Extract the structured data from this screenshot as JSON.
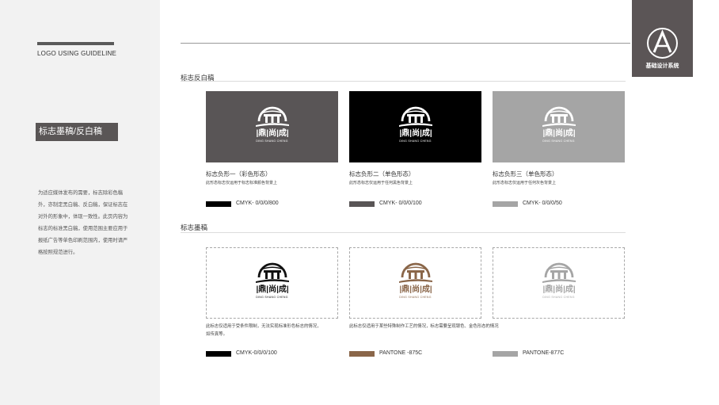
{
  "sidebar": {
    "guide_title": "LOGO USING GUIDELINE",
    "section_title": "标志墨稿/反白稿",
    "description": "为适应媒体发布的需要，标志除彩色稿外，亦制定黑白稿、反白稿，保证标志在对外的形象中，体现一致性。此页内容为标志的标准黑白稿，使用范围主要应用于报纸广告等单色印刷范围内，使用时请严格按照规范进行。"
  },
  "corner_badge": {
    "text": "基础设计系统",
    "icon": "a-monogram-icon"
  },
  "logo": {
    "wordmark": "|鼎|尚|成|",
    "subtitle": "DING SHANG CHENG"
  },
  "reverse": {
    "heading": "标志反白稿",
    "items": [
      {
        "title": "标志负形一（彩色形态）",
        "subtitle": "此形态标志仅运用于标志标准颜色背景上",
        "code": "CMYK- 0/0/0/800",
        "bg": "#595556",
        "swatch": "#000000",
        "mark": "#ffffff"
      },
      {
        "title": "标志负形二（单色形态）",
        "subtitle": "此形态标志仅运用于任何黑色背景上",
        "code": "CMYK- 0/0/0/100",
        "bg": "#000000",
        "swatch": "#595556",
        "mark": "#ffffff"
      },
      {
        "title": "标志负形三（单色形态）",
        "subtitle": "此形态标志仅运用于任何灰色背景上",
        "code": "CMYK- 0/0/0/50",
        "bg": "#a5a5a5",
        "swatch": "#a5a5a5",
        "mark": "#ffffff"
      }
    ]
  },
  "ink": {
    "heading": "标志墨稿",
    "items": [
      {
        "note": "此标志仅适用于受条件限制，无法实现标准形色标志的情况，如传真等。",
        "code": "CMYK-0/0/0/100",
        "swatch": "#000000",
        "mark": "#111111"
      },
      {
        "note": "此标志仅适用于某些特殊制作工艺的情况，标志需要呈现银色、金色形态的情况",
        "code": "PANTONE -875C",
        "swatch": "#8a6649",
        "mark": "#8a6649"
      },
      {
        "note": "",
        "code": "PANTONE-877C",
        "swatch": "#a5a5a5",
        "mark": "#a5a5a5"
      }
    ]
  }
}
